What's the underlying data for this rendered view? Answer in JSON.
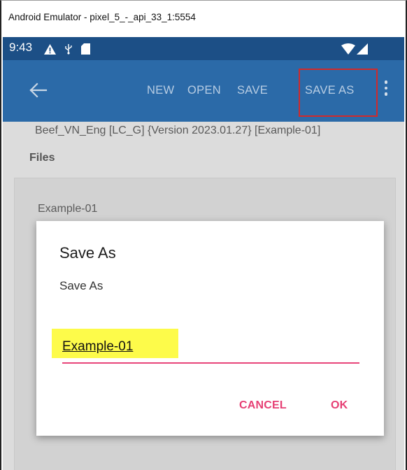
{
  "window": {
    "title": "Android Emulator - pixel_5_-_api_33_1:5554"
  },
  "status_bar": {
    "time": "9:43",
    "left_icons": [
      "alert-icon",
      "usb-icon",
      "sd-card-icon"
    ],
    "right_icons": [
      "wifi-icon",
      "signal-icon"
    ],
    "background": "#1c4f86"
  },
  "app_bar": {
    "background": "#2b6aa8",
    "back_icon": "arrow-left-icon",
    "actions": {
      "new": "NEW",
      "open": "OPEN",
      "save": "SAVE",
      "save_as": "SAVE AS"
    },
    "overflow_icon": "more-vert-icon",
    "highlight_color": "#d12a2a"
  },
  "page": {
    "document_line": "Beef_VN_Eng [LC_G] {Version 2023.01.27} [Example-01]",
    "files_heading": "Files",
    "files": [
      "Example-01"
    ]
  },
  "dialog": {
    "title": "Save As",
    "message": "Save As",
    "input_value": "Example-01",
    "cancel_label": "CANCEL",
    "ok_label": "OK",
    "accent_color": "#e63f74",
    "highlight_color": "#fdfb4a"
  }
}
